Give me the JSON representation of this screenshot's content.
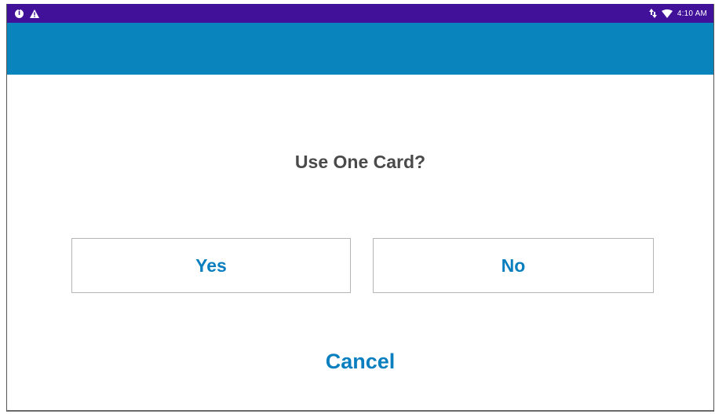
{
  "status_bar": {
    "left_icons": [
      "info-icon",
      "warning-icon"
    ],
    "right_icons": [
      "signal-icon",
      "wifi-icon"
    ],
    "time": "4:10 AM",
    "background": "#41119a"
  },
  "app_bar": {
    "background": "#0a84bd"
  },
  "dialog": {
    "question": "Use One Card?",
    "yes_label": "Yes",
    "no_label": "No",
    "cancel_label": "Cancel",
    "accent": "#0a7fbf"
  }
}
